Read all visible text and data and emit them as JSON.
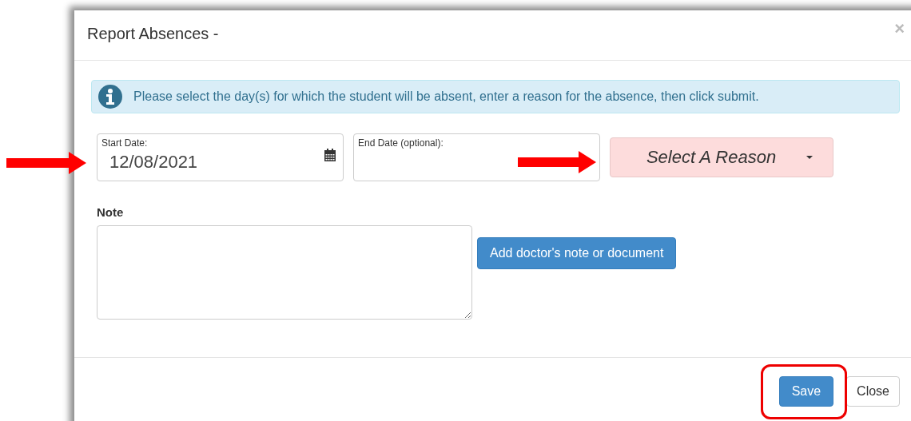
{
  "dialog": {
    "title": "Report Absences -",
    "close_label": "×"
  },
  "alert": {
    "text": "Please select the day(s) for which the student will be absent, enter a reason for the absence, then click submit."
  },
  "start_date": {
    "label": "Start Date:",
    "value": "12/08/2021"
  },
  "end_date": {
    "label": "End Date (optional):"
  },
  "reason": {
    "label": "Select A Reason"
  },
  "note": {
    "label": "Note"
  },
  "attach_button": {
    "label": "Add doctor's note or document"
  },
  "footer_buttons": [
    {
      "label": "Save",
      "kind": "primary"
    },
    {
      "label": "Close",
      "kind": "default"
    }
  ],
  "annotations": [
    {
      "kind": "arrow"
    },
    {
      "kind": "arrow"
    },
    {
      "kind": "highlight"
    }
  ]
}
